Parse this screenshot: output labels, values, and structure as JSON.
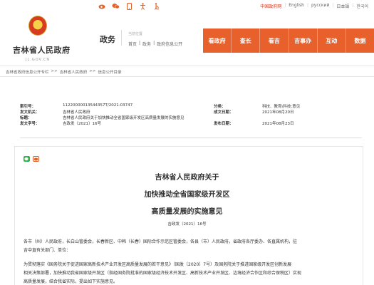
{
  "top": {
    "lang": [
      "中国政府网",
      "English",
      "русский",
      "日本語",
      "한국어"
    ],
    "icons": [
      "weibo-icon",
      "wechat-icon",
      "mobile-icon",
      "accessibility-icon",
      "elder-icon"
    ]
  },
  "header": {
    "site_name": "吉林省人民政府",
    "site_domain": "JL.GOV.CN",
    "section": "政务",
    "loc_label": "当前位置",
    "breadcrumb": [
      "首页",
      "|",
      "政务",
      "|",
      "政府信息公开"
    ],
    "nav": [
      "看政府",
      "查长",
      "看吉",
      "吉事办",
      "互动",
      "数据"
    ]
  },
  "crumb": [
    "吉林省政府信息公开专栏",
    ">>",
    "吉林省人民政府",
    ">>",
    "信息公开目录"
  ],
  "meta": {
    "index_label": "索引号：",
    "index_value": "11220000013544357T/2021-03747",
    "category_label": "分类：",
    "category_value": "科技、教育\\科技;意见",
    "issuer_label": "发文机关：",
    "issuer_value": "吉林省人民政府",
    "written_label": "成文日期：",
    "written_value": "2021年08月20日",
    "title_label": "标题：",
    "title_value": "吉林省人民政府关于加快推动全省国家级开发区高质量发展的实施意见",
    "number_label": "发文字号：",
    "number_value": "吉政发〔2021〕16号",
    "published_label": "发布日期：",
    "published_value": "2021年08月23日"
  },
  "doc": {
    "title1": "吉林省人民政府关于",
    "title2": "加快推动全省国家级开发区",
    "title3": "高质量发展的实施意见",
    "number": "吉政发〔2021〕16号",
    "para1_line1": "各市（州）人民政府，长白山管委会，长春新区、中韩（长春）国际合作示范区管委会，各县（市）人民政府，省政府各厅委办、各直属机构，驻",
    "para1_line2": "吉中直有关部门、单位：",
    "para2_line1": "为贯彻落实《国务院关于促进国家高新技术产业开发区高质量发展的若干意见》（国发〔2020〕7号）及国务院关于推进国家级开发区创新发展",
    "para2_line2": "相关决策部署，加快推动我省国家级开发区（指经国务院批准的国家级经济技术开发区、高新技术产业开发区、边境经济合作区和综合保税区）实现",
    "para2_line3": "高质量发展，结合我省实际，提出如下实施意见。"
  },
  "colors": {
    "accent": "#e8612c",
    "cn_link": "#d0361e",
    "wechat": "#2fb34a"
  }
}
